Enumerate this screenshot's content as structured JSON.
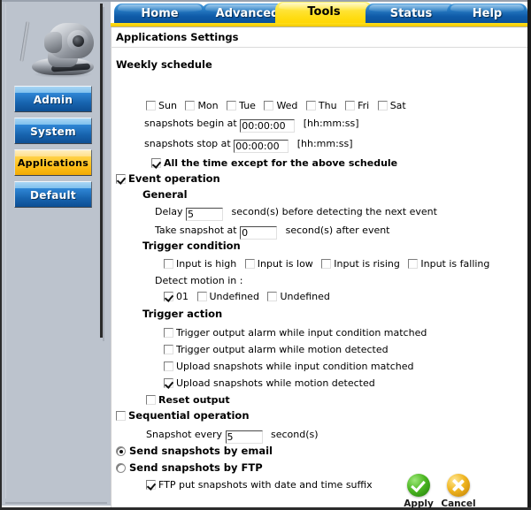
{
  "window": {
    "page_title": "Applications Settings"
  },
  "tabs": [
    {
      "label": "Home",
      "selected": false
    },
    {
      "label": "Advanced",
      "selected": false
    },
    {
      "label": "Tools",
      "selected": true
    },
    {
      "label": "Status",
      "selected": false
    },
    {
      "label": "Help",
      "selected": false
    }
  ],
  "sidebar": {
    "device_icon": "ip-camera-icon",
    "items": [
      {
        "label": "Admin",
        "active": false
      },
      {
        "label": "System",
        "active": false
      },
      {
        "label": "Applications",
        "active": true
      },
      {
        "label": "Default",
        "active": false
      }
    ]
  },
  "form": {
    "weekly_schedule": {
      "heading": "Weekly schedule",
      "days": [
        {
          "label": "Sun",
          "checked": false
        },
        {
          "label": "Mon",
          "checked": false
        },
        {
          "label": "Tue",
          "checked": false
        },
        {
          "label": "Wed",
          "checked": false
        },
        {
          "label": "Thu",
          "checked": false
        },
        {
          "label": "Fri",
          "checked": false
        },
        {
          "label": "Sat",
          "checked": false
        }
      ],
      "begin_label": "snapshots begin at",
      "begin_value": "00:00:00",
      "begin_hint": "[hh:mm:ss]",
      "stop_label": "snapshots stop at",
      "stop_value": "00:00:00",
      "stop_hint": "[hh:mm:ss]",
      "all_time_label": "All the time except for the above schedule",
      "all_time_checked": true
    },
    "event_operation": {
      "label": "Event operation",
      "checked": true,
      "general_heading": "General",
      "delay_prefix": "Delay",
      "delay_value": "5",
      "delay_suffix": "second(s) before detecting the next event",
      "snapshot_prefix": "Take snapshot at",
      "snapshot_value": "0",
      "snapshot_suffix": "second(s) after event",
      "trigger_condition_heading": "Trigger condition",
      "conditions": [
        {
          "label": "Input is high",
          "checked": false
        },
        {
          "label": "Input is low",
          "checked": false
        },
        {
          "label": "Input is rising",
          "checked": false
        },
        {
          "label": "Input is falling",
          "checked": false
        }
      ],
      "detect_motion_label": "Detect motion in :",
      "motion_windows": [
        {
          "label": "01",
          "checked": true
        },
        {
          "label": "Undefined",
          "checked": false
        },
        {
          "label": "Undefined",
          "checked": false
        }
      ],
      "trigger_action_heading": "Trigger action",
      "actions": [
        {
          "label": "Trigger output alarm while input condition matched",
          "checked": false
        },
        {
          "label": "Trigger output alarm while motion detected",
          "checked": false
        },
        {
          "label": "Upload snapshots while input condition matched",
          "checked": false
        },
        {
          "label": "Upload snapshots while motion detected",
          "checked": true
        }
      ],
      "reset_output_label": "Reset output",
      "reset_output_checked": false
    },
    "sequential_operation": {
      "label": "Sequential operation",
      "checked": false,
      "snapshot_prefix": "Snapshot every",
      "snapshot_value": "5",
      "snapshot_suffix": "second(s)"
    },
    "delivery": {
      "selected": "email",
      "options": [
        {
          "id": "email",
          "label": "Send snapshots by email",
          "selected": true
        },
        {
          "id": "ftp",
          "label": "Send snapshots by FTP",
          "selected": false
        }
      ],
      "ftp_suffix_label": "FTP put snapshots with date and time suffix",
      "ftp_suffix_checked": true
    }
  },
  "actions": {
    "apply": {
      "label": "Apply",
      "icon": "check-circle-icon"
    },
    "cancel": {
      "label": "Cancel",
      "icon": "x-circle-icon"
    }
  },
  "colors": {
    "tab_blue": "#0f5ba8",
    "tab_selected_yellow": "#ffdc12",
    "accent_yellow_bar": "#ffe01b",
    "sidebar_gray": "#bcc3cd",
    "button_blue": "#1763ae",
    "button_active_gold": "#fdbe18",
    "apply_green": "#4cb722",
    "cancel_gold": "#f0b622"
  }
}
